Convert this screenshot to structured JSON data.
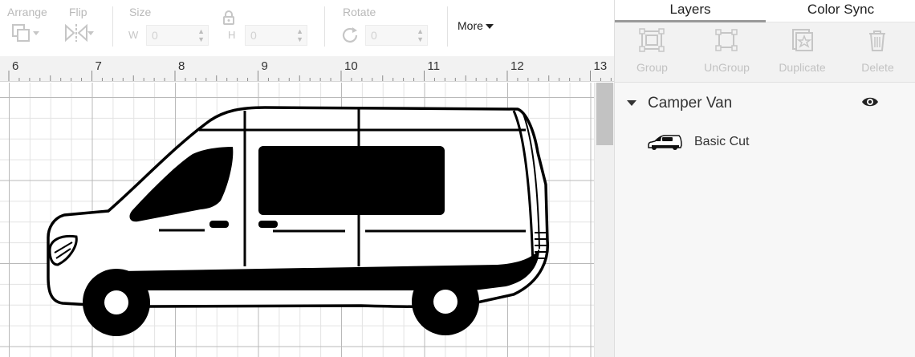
{
  "toolbar": {
    "arrange_label": "Arrange",
    "flip_label": "Flip",
    "size_label": "Size",
    "width_prefix": "W",
    "width_value": "0",
    "height_prefix": "H",
    "height_value": "0",
    "rotate_label": "Rotate",
    "rotate_value": "0",
    "more_label": "More",
    "icons": [
      "arrange-icon",
      "flip-icon",
      "lock-icon",
      "rotate-icon",
      "caret-down-icon"
    ]
  },
  "ruler": {
    "labels": [
      "6",
      "7",
      "8",
      "9",
      "10",
      "11",
      "12",
      "13"
    ]
  },
  "panel": {
    "tabs": [
      {
        "label": "Layers",
        "active": true
      },
      {
        "label": "Color Sync",
        "active": false
      }
    ],
    "actions": [
      {
        "label": "Group",
        "icon": "group-icon",
        "enabled": false
      },
      {
        "label": "UnGroup",
        "icon": "ungroup-icon",
        "enabled": false
      },
      {
        "label": "Duplicate",
        "icon": "duplicate-icon",
        "enabled": false
      },
      {
        "label": "Delete",
        "icon": "trash-icon",
        "enabled": false
      }
    ],
    "group": {
      "name": "Camper Van",
      "expanded": true,
      "visible": true
    },
    "layer": {
      "name": "Basic Cut",
      "thumbnail": "camper-van-thumbnail"
    }
  },
  "colors": {
    "accent_tab": "#999999",
    "grid_major": "#b9b9b9",
    "grid_minor": "#e3e3e3",
    "disabled_text": "#c2c2c2",
    "shape_fill": "#000000"
  }
}
